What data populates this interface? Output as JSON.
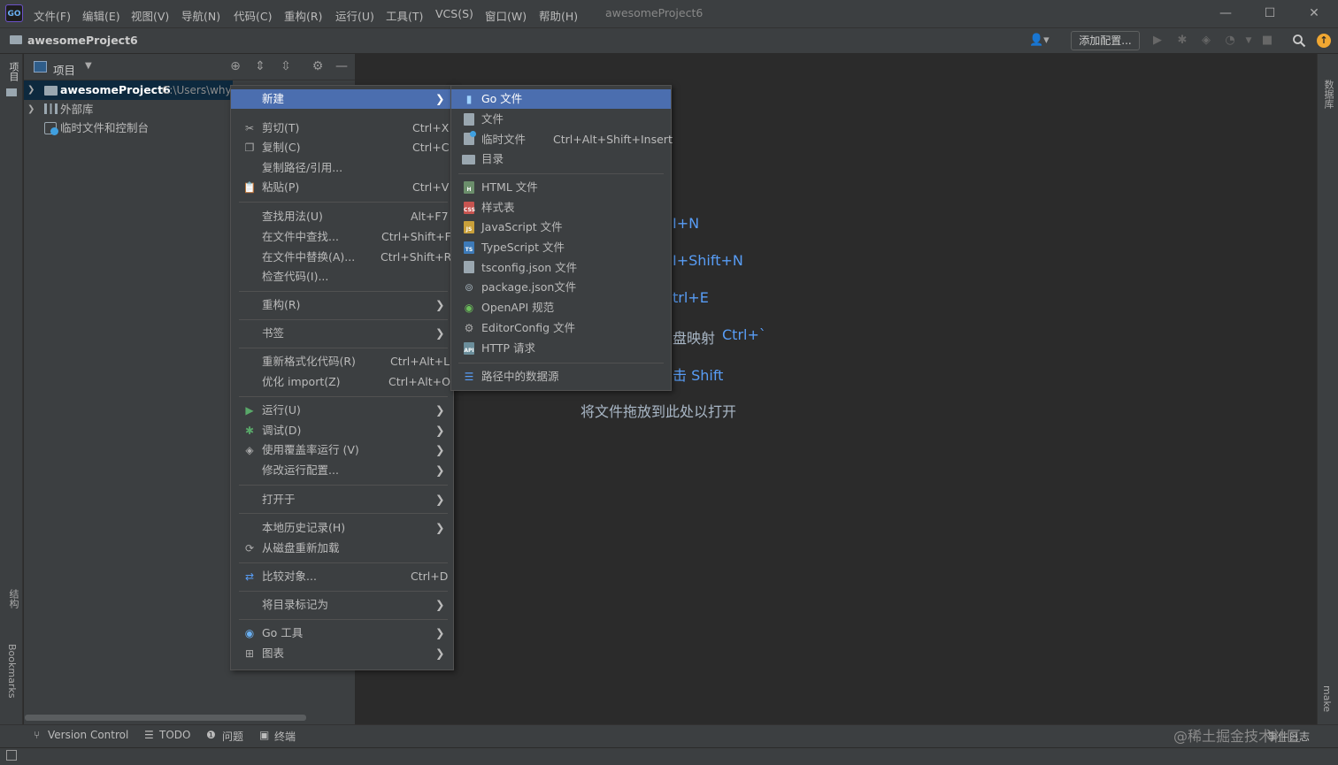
{
  "menubar": {
    "items": [
      "文件(F)",
      "编辑(E)",
      "视图(V)",
      "导航(N)",
      "代码(C)",
      "重构(R)",
      "运行(U)",
      "工具(T)",
      "VCS(S)",
      "窗口(W)",
      "帮助(H)"
    ],
    "window_title": "awesomeProject6",
    "logo_text": "GO"
  },
  "window_controls": {
    "minimize": "—",
    "maximize": "☐",
    "close": "✕"
  },
  "navbar": {
    "project_name": "awesomeProject6",
    "user_icon": "👤▾",
    "add_config": "添加配置..."
  },
  "left_stripe": {
    "project_tab": "项目",
    "structure_tab": "结构",
    "bookmarks_tab": "Bookmarks"
  },
  "right_stripe": {
    "database_tab": "数据库",
    "make_tab": "make"
  },
  "project_panel": {
    "title": "项目",
    "tree": [
      {
        "label": "awesomeProject6",
        "path": "C:\\Users\\why\\"
      },
      {
        "label": "外部库"
      },
      {
        "label": "临时文件和控制台"
      }
    ]
  },
  "editor": {
    "hints": [
      {
        "label": "",
        "shortcut": "I+N"
      },
      {
        "label": "",
        "shortcut": "I+Shift+N"
      },
      {
        "label": "",
        "shortcut": "trl+E"
      },
      {
        "label": "盘映射",
        "shortcut": "Ctrl+`"
      },
      {
        "label": "",
        "shortcut": "击 Shift"
      }
    ],
    "drop_hint": "将文件拖放到此处以打开"
  },
  "context_menu": {
    "items": [
      {
        "label": "新建",
        "shortcut": "",
        "submenu": true,
        "selected": true
      },
      {
        "label": "剪切(T)",
        "shortcut": "Ctrl+X",
        "icon": "cut-icon"
      },
      {
        "label": "复制(C)",
        "shortcut": "Ctrl+C",
        "icon": "copy-icon"
      },
      {
        "label": "复制路径/引用...",
        "shortcut": ""
      },
      {
        "label": "粘贴(P)",
        "shortcut": "Ctrl+V",
        "icon": "paste-icon"
      },
      {
        "label": "查找用法(U)",
        "shortcut": "Alt+F7"
      },
      {
        "label": "在文件中查找...",
        "shortcut": "Ctrl+Shift+F"
      },
      {
        "label": "在文件中替换(A)...",
        "shortcut": "Ctrl+Shift+R"
      },
      {
        "label": "检查代码(I)...",
        "shortcut": ""
      },
      {
        "label": "重构(R)",
        "submenu": true
      },
      {
        "label": "书签",
        "submenu": true
      },
      {
        "label": "重新格式化代码(R)",
        "shortcut": "Ctrl+Alt+L"
      },
      {
        "label": "优化 import(Z)",
        "shortcut": "Ctrl+Alt+O"
      },
      {
        "label": "运行(U)",
        "submenu": true,
        "icon": "run-icon"
      },
      {
        "label": "调试(D)",
        "submenu": true,
        "icon": "debug-icon"
      },
      {
        "label": "使用覆盖率运行 (V)",
        "submenu": true,
        "icon": "coverage-icon"
      },
      {
        "label": "修改运行配置...",
        "submenu": true
      },
      {
        "label": "打开于",
        "submenu": true
      },
      {
        "label": "本地历史记录(H)",
        "submenu": true
      },
      {
        "label": "从磁盘重新加载",
        "icon": "reload-icon"
      },
      {
        "label": "比较对象...",
        "shortcut": "Ctrl+D",
        "icon": "compare-icon"
      },
      {
        "label": "将目录标记为",
        "submenu": true
      },
      {
        "label": "Go 工具",
        "submenu": true,
        "icon": "go-tools-icon"
      },
      {
        "label": "图表",
        "submenu": true,
        "icon": "diagram-icon"
      }
    ]
  },
  "submenu": {
    "items": [
      {
        "label": "Go 文件",
        "selected": true
      },
      {
        "label": "文件"
      },
      {
        "label": "临时文件",
        "shortcut": "Ctrl+Alt+Shift+Insert"
      },
      {
        "label": "目录"
      },
      {
        "label": "HTML 文件"
      },
      {
        "label": "样式表"
      },
      {
        "label": "JavaScript 文件"
      },
      {
        "label": "TypeScript 文件"
      },
      {
        "label": "tsconfig.json 文件"
      },
      {
        "label": "package.json文件"
      },
      {
        "label": "OpenAPI 规范"
      },
      {
        "label": "EditorConfig 文件"
      },
      {
        "label": "HTTP 请求"
      },
      {
        "label": "路径中的数据源"
      }
    ]
  },
  "bottom_bar": {
    "version_control": "Version Control",
    "todo": "TODO",
    "problems": "问题",
    "terminal": "终端",
    "event_log": "事件日志"
  },
  "watermark": "@稀土掘金技术社区",
  "colors": {
    "selection": "#4b6eaf",
    "background": "#2b2b2b",
    "panel": "#3c3f41",
    "hint_blue": "#589df6"
  }
}
